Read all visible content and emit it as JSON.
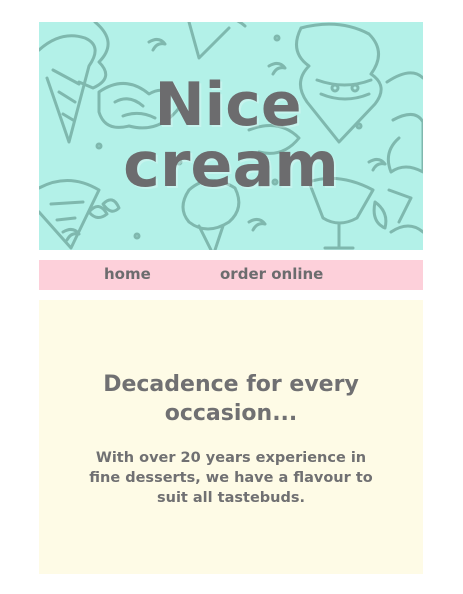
{
  "brand": {
    "line1": "Nice",
    "line2": "cream"
  },
  "hero": {
    "background": "#b3f1e8",
    "pattern_color": "#7fb8ae",
    "logo_color": "#6c6c6e"
  },
  "nav": {
    "background": "#fdd0da",
    "items": [
      {
        "label": "home"
      },
      {
        "label": "order online"
      }
    ]
  },
  "main": {
    "background": "#fefbe6",
    "headline": "Decadence for every occasion...",
    "body": "With over 20 years experience in fine desserts, we have a flavour to suit all tastebuds."
  }
}
